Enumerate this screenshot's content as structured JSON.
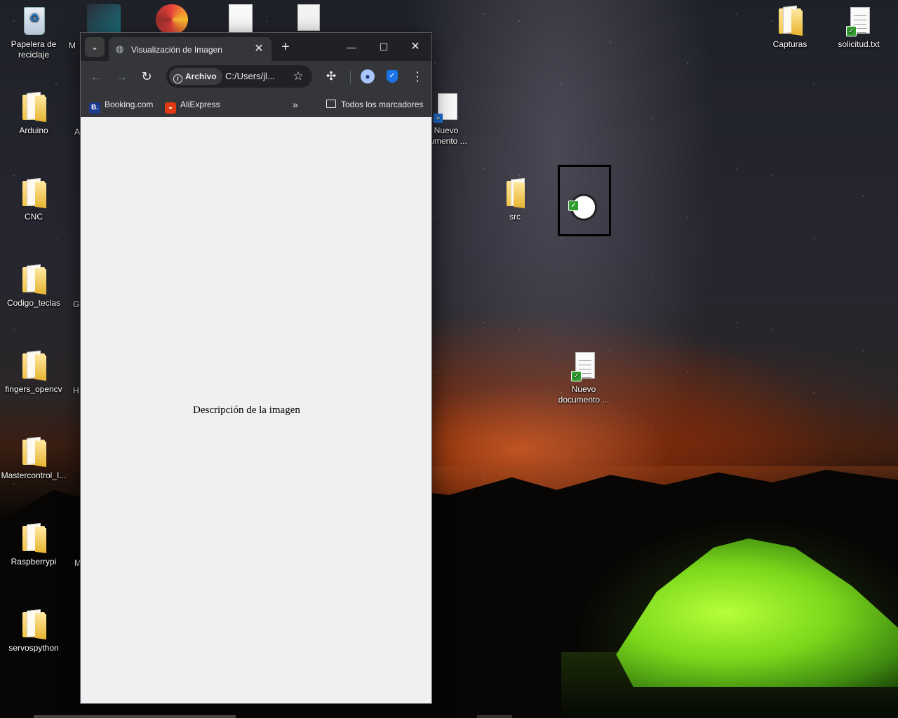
{
  "desktop": {
    "left_icons": [
      {
        "label": "Papelera de reciclaje",
        "icon": "recycle-bin-icon"
      },
      {
        "label": "Arduino",
        "icon": "folder-icon"
      },
      {
        "label": "CNC",
        "icon": "folder-icon"
      },
      {
        "label": "Codigo_teclas",
        "icon": "folder-icon"
      },
      {
        "label": "fingers_opencv",
        "icon": "folder-icon"
      },
      {
        "label": "Mastercontrol_I...",
        "icon": "folder-icon"
      },
      {
        "label": "Raspberrypi",
        "icon": "folder-icon"
      },
      {
        "label": "servospython",
        "icon": "folder-icon"
      }
    ],
    "partial_labels": [
      "M",
      "A",
      "G",
      "H",
      "M"
    ],
    "right_icons": [
      {
        "label": "Capturas",
        "icon": "folder-icon"
      },
      {
        "label": "solicitud.txt",
        "icon": "text-document-icon"
      }
    ],
    "middle_icons": [
      {
        "label_line1": "Nuevo",
        "label_line2": "cumento ...",
        "icon": "shortcut-document-icon"
      },
      {
        "label": "src",
        "icon": "folder-icon"
      },
      {
        "label_line1": "Nuevo",
        "label_line2": "documento ...",
        "icon": "text-document-icon"
      }
    ]
  },
  "browser": {
    "tab_title": "Visualización de Imagen",
    "address": {
      "chip": "Archivo",
      "url": "C:/Users/jl..."
    },
    "bookmarks": [
      {
        "label": "Booking.com",
        "icon_letter": "B."
      },
      {
        "label": "AliExpress",
        "icon_letter": "◒"
      }
    ],
    "bookmarks_overflow": "»",
    "all_bookmarks": "Todos los marcadores",
    "content": {
      "image_alt": "Descripción de la imagen"
    }
  }
}
